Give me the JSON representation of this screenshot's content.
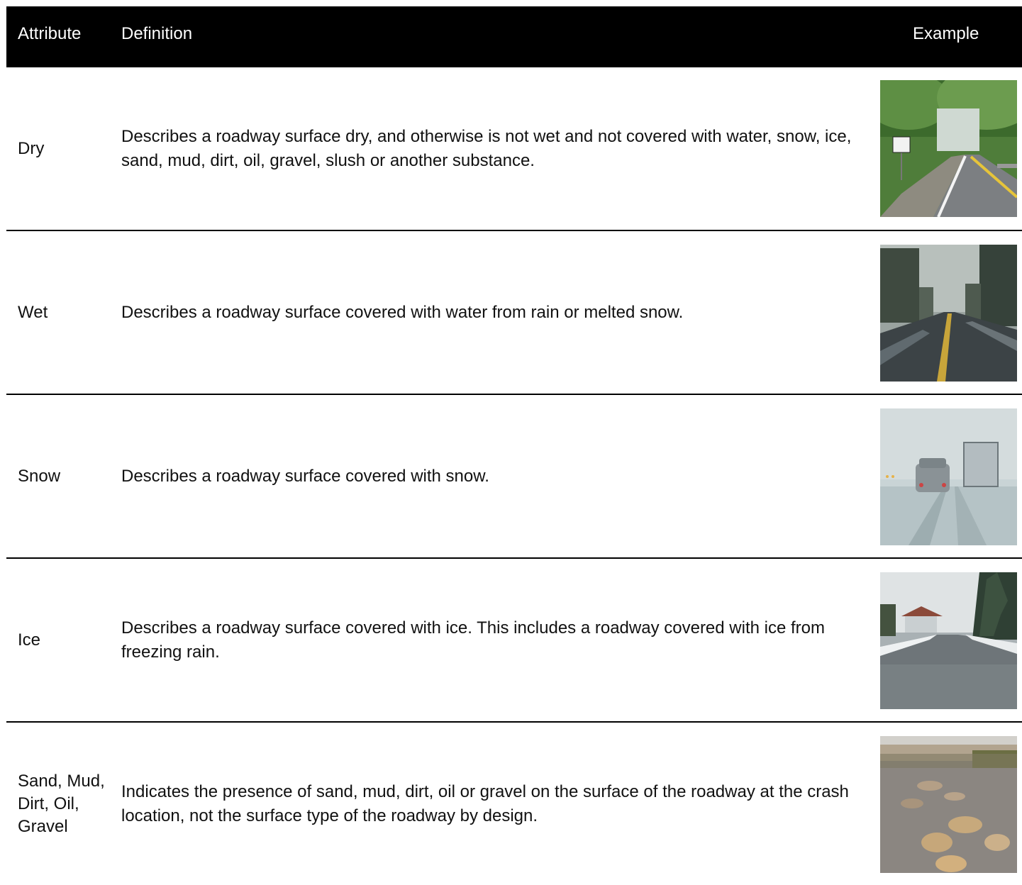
{
  "header": {
    "attribute": "Attribute",
    "definition": "Definition",
    "example": "Example"
  },
  "rows": [
    {
      "attribute": "Dry",
      "definition": "Describes a roadway surface dry, and otherwise is not wet and not covered with water, snow, ice, sand, mud, dirt, oil, gravel, slush or another substance.",
      "example_image": "dry-road-photo"
    },
    {
      "attribute": "Wet",
      "definition": "Describes a roadway surface covered with water from rain or melted snow.",
      "example_image": "wet-road-photo"
    },
    {
      "attribute": "Snow",
      "definition": "Describes a roadway surface covered with snow.",
      "example_image": "snow-road-photo"
    },
    {
      "attribute": "Ice",
      "definition": "Describes a roadway surface covered with ice. This includes a roadway covered with ice from freezing rain.",
      "example_image": "ice-road-photo"
    },
    {
      "attribute": "Sand, Mud, Dirt, Oil, Gravel",
      "definition": "Indicates the presence of sand, mud, dirt, oil or gravel on the surface of the roadway at the crash location, not the surface type of the roadway by design.",
      "example_image": "gravel-road-photo"
    }
  ]
}
